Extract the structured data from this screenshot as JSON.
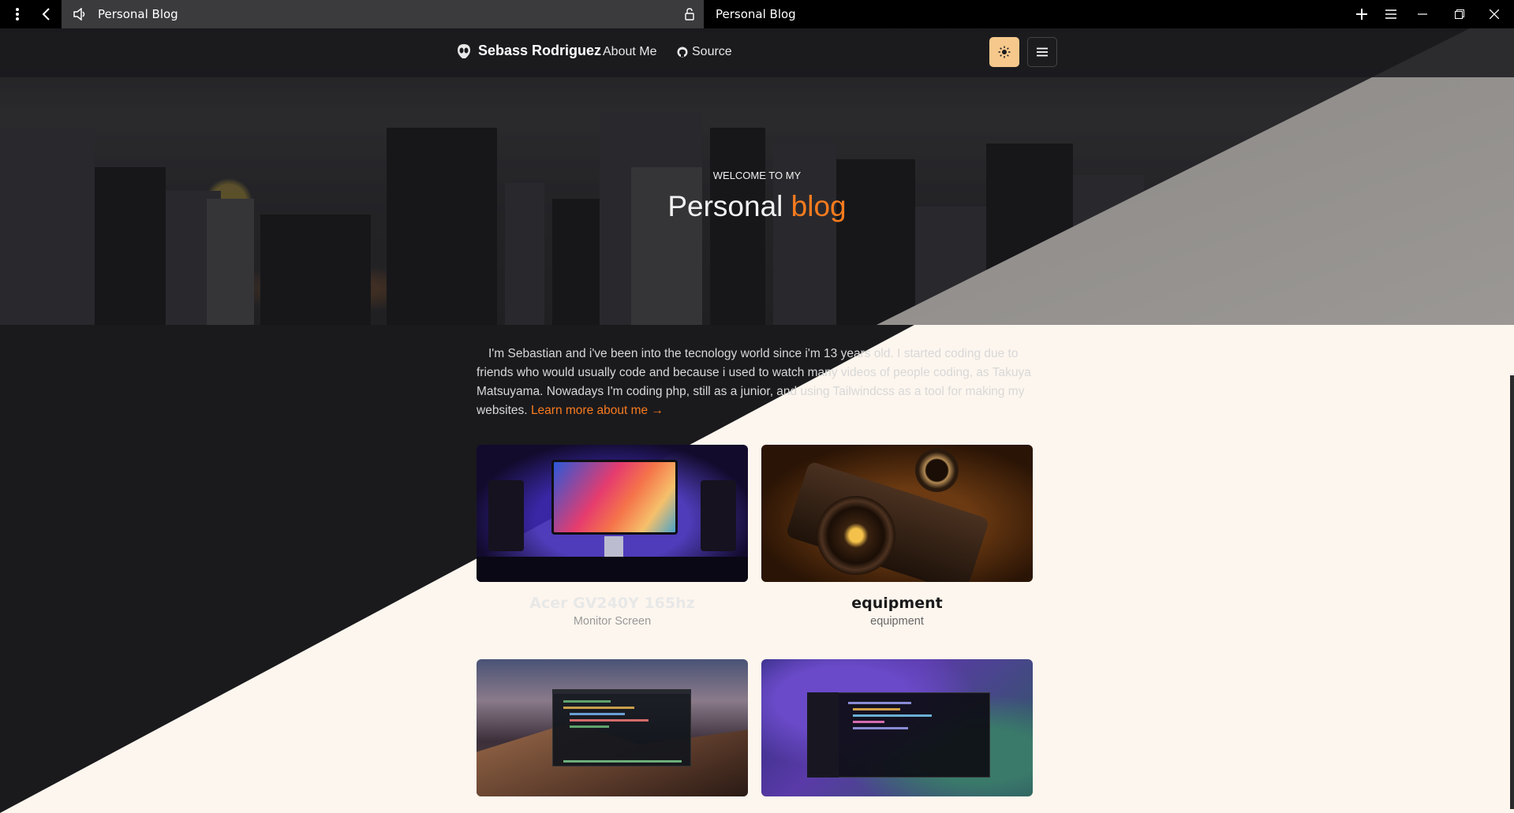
{
  "browser": {
    "active_tab_title": "Personal Blog",
    "inactive_tab_title": "Personal Blog"
  },
  "nav": {
    "brand": "Sebass Rodriguez",
    "about_label": "About Me",
    "source_label": "Source"
  },
  "hero": {
    "eyebrow": "WELCOME TO MY",
    "title_main": "Personal",
    "title_accent": "blog"
  },
  "intro": {
    "text": "I'm Sebastian and i've been into the tecnology world since i'm 13 years old. I started coding due to friends who would usually code and because i used to watch many videos of people coding, as Takuya Matsuyama. Nowadays I'm coding php, still as a junior, and using Tailwindcss as a tool for making my websites.",
    "link_label": "Learn more about me →"
  },
  "cards": [
    {
      "title": "Acer GV240Y 165hz",
      "subtitle": "Monitor Screen"
    },
    {
      "title": "equipment",
      "subtitle": "equipment"
    },
    {
      "title": "",
      "subtitle": ""
    },
    {
      "title": "",
      "subtitle": ""
    }
  ],
  "colors": {
    "accent": "#f97b1e",
    "dark_bg": "#1a1a1d",
    "light_bg": "#fdf6ee",
    "theme_button": "#f6c88c"
  }
}
